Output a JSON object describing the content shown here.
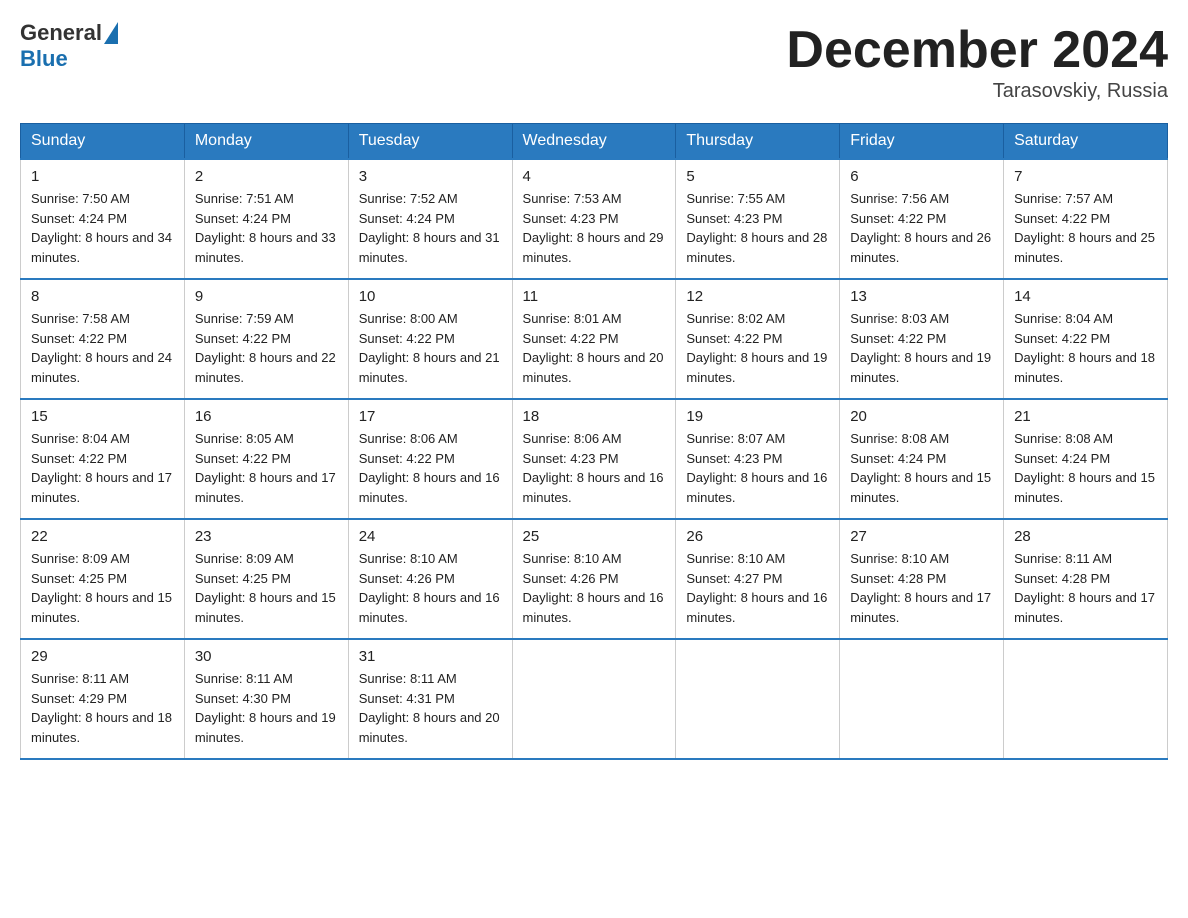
{
  "header": {
    "logo_general": "General",
    "logo_blue": "Blue",
    "month_title": "December 2024",
    "location": "Tarasovskiy, Russia"
  },
  "days_of_week": [
    "Sunday",
    "Monday",
    "Tuesday",
    "Wednesday",
    "Thursday",
    "Friday",
    "Saturday"
  ],
  "weeks": [
    [
      {
        "day": "1",
        "sunrise": "7:50 AM",
        "sunset": "4:24 PM",
        "daylight": "8 hours and 34 minutes."
      },
      {
        "day": "2",
        "sunrise": "7:51 AM",
        "sunset": "4:24 PM",
        "daylight": "8 hours and 33 minutes."
      },
      {
        "day": "3",
        "sunrise": "7:52 AM",
        "sunset": "4:24 PM",
        "daylight": "8 hours and 31 minutes."
      },
      {
        "day": "4",
        "sunrise": "7:53 AM",
        "sunset": "4:23 PM",
        "daylight": "8 hours and 29 minutes."
      },
      {
        "day": "5",
        "sunrise": "7:55 AM",
        "sunset": "4:23 PM",
        "daylight": "8 hours and 28 minutes."
      },
      {
        "day": "6",
        "sunrise": "7:56 AM",
        "sunset": "4:22 PM",
        "daylight": "8 hours and 26 minutes."
      },
      {
        "day": "7",
        "sunrise": "7:57 AM",
        "sunset": "4:22 PM",
        "daylight": "8 hours and 25 minutes."
      }
    ],
    [
      {
        "day": "8",
        "sunrise": "7:58 AM",
        "sunset": "4:22 PM",
        "daylight": "8 hours and 24 minutes."
      },
      {
        "day": "9",
        "sunrise": "7:59 AM",
        "sunset": "4:22 PM",
        "daylight": "8 hours and 22 minutes."
      },
      {
        "day": "10",
        "sunrise": "8:00 AM",
        "sunset": "4:22 PM",
        "daylight": "8 hours and 21 minutes."
      },
      {
        "day": "11",
        "sunrise": "8:01 AM",
        "sunset": "4:22 PM",
        "daylight": "8 hours and 20 minutes."
      },
      {
        "day": "12",
        "sunrise": "8:02 AM",
        "sunset": "4:22 PM",
        "daylight": "8 hours and 19 minutes."
      },
      {
        "day": "13",
        "sunrise": "8:03 AM",
        "sunset": "4:22 PM",
        "daylight": "8 hours and 19 minutes."
      },
      {
        "day": "14",
        "sunrise": "8:04 AM",
        "sunset": "4:22 PM",
        "daylight": "8 hours and 18 minutes."
      }
    ],
    [
      {
        "day": "15",
        "sunrise": "8:04 AM",
        "sunset": "4:22 PM",
        "daylight": "8 hours and 17 minutes."
      },
      {
        "day": "16",
        "sunrise": "8:05 AM",
        "sunset": "4:22 PM",
        "daylight": "8 hours and 17 minutes."
      },
      {
        "day": "17",
        "sunrise": "8:06 AM",
        "sunset": "4:22 PM",
        "daylight": "8 hours and 16 minutes."
      },
      {
        "day": "18",
        "sunrise": "8:06 AM",
        "sunset": "4:23 PM",
        "daylight": "8 hours and 16 minutes."
      },
      {
        "day": "19",
        "sunrise": "8:07 AM",
        "sunset": "4:23 PM",
        "daylight": "8 hours and 16 minutes."
      },
      {
        "day": "20",
        "sunrise": "8:08 AM",
        "sunset": "4:24 PM",
        "daylight": "8 hours and 15 minutes."
      },
      {
        "day": "21",
        "sunrise": "8:08 AM",
        "sunset": "4:24 PM",
        "daylight": "8 hours and 15 minutes."
      }
    ],
    [
      {
        "day": "22",
        "sunrise": "8:09 AM",
        "sunset": "4:25 PM",
        "daylight": "8 hours and 15 minutes."
      },
      {
        "day": "23",
        "sunrise": "8:09 AM",
        "sunset": "4:25 PM",
        "daylight": "8 hours and 15 minutes."
      },
      {
        "day": "24",
        "sunrise": "8:10 AM",
        "sunset": "4:26 PM",
        "daylight": "8 hours and 16 minutes."
      },
      {
        "day": "25",
        "sunrise": "8:10 AM",
        "sunset": "4:26 PM",
        "daylight": "8 hours and 16 minutes."
      },
      {
        "day": "26",
        "sunrise": "8:10 AM",
        "sunset": "4:27 PM",
        "daylight": "8 hours and 16 minutes."
      },
      {
        "day": "27",
        "sunrise": "8:10 AM",
        "sunset": "4:28 PM",
        "daylight": "8 hours and 17 minutes."
      },
      {
        "day": "28",
        "sunrise": "8:11 AM",
        "sunset": "4:28 PM",
        "daylight": "8 hours and 17 minutes."
      }
    ],
    [
      {
        "day": "29",
        "sunrise": "8:11 AM",
        "sunset": "4:29 PM",
        "daylight": "8 hours and 18 minutes."
      },
      {
        "day": "30",
        "sunrise": "8:11 AM",
        "sunset": "4:30 PM",
        "daylight": "8 hours and 19 minutes."
      },
      {
        "day": "31",
        "sunrise": "8:11 AM",
        "sunset": "4:31 PM",
        "daylight": "8 hours and 20 minutes."
      },
      null,
      null,
      null,
      null
    ]
  ]
}
